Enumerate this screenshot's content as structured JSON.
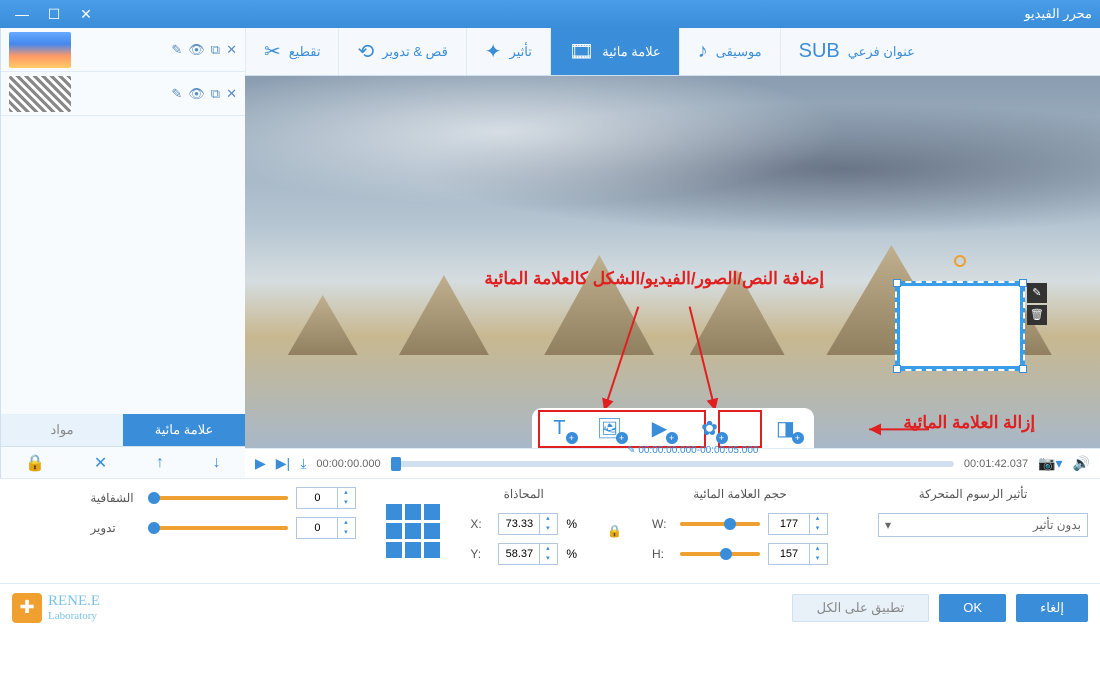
{
  "window": {
    "title": "محرر الفيديو"
  },
  "tabs": {
    "cut": "تقطيع",
    "crop": "قص & تدوير",
    "effect": "تأثير",
    "watermark": "علامة مائية",
    "music": "موسيقى",
    "subtitle": "عنوان فرعي"
  },
  "sidebar": {
    "tab_watermark": "علامة مائية",
    "tab_materials": "مواد"
  },
  "timeline": {
    "current": "00:00:00.000",
    "range": "00:00:00.000-00:00:05.000",
    "duration": "00:01:42.037"
  },
  "annotations": {
    "add_watermark": "إضافة النص/الصور/الفيديو/الشكل كالعلامة المائية",
    "remove_watermark": "إزالة العلامة المائية"
  },
  "props": {
    "animation_label": "تأثير الرسوم المتحركة",
    "animation_value": "بدون تأثير",
    "size_label": "حجم العلامة المائية",
    "w_label": "W:",
    "h_label": "H:",
    "w_value": "177",
    "h_value": "157",
    "align_label": "المحاذاة",
    "x_label": "X:",
    "y_label": "Y:",
    "x_value": "73.33",
    "y_value": "58.37",
    "pct": "%",
    "opacity_label": "الشفافية",
    "rotate_label": "تدوير",
    "opacity_value": "0",
    "rotate_value": "0"
  },
  "footer": {
    "brand1": "RENE.E",
    "brand2": "Laboratory",
    "apply_all": "تطبيق على الكل",
    "ok": "OK",
    "cancel": "إلغاء"
  }
}
